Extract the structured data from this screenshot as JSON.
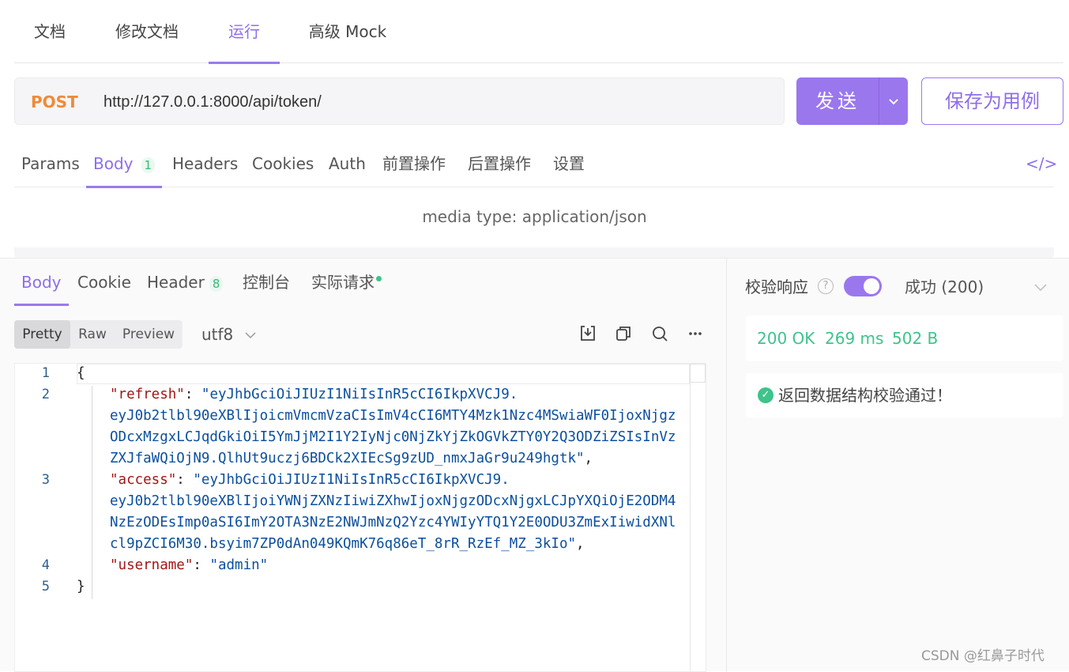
{
  "top_tabs": [
    "文档",
    "修改文档",
    "运行",
    "高级 Mock"
  ],
  "request": {
    "method": "POST",
    "url": "http://127.0.0.1:8000/api/token/",
    "send_label": "发送",
    "save_label": "保存为用例"
  },
  "req_tabs": {
    "params": "Params",
    "body": "Body",
    "body_count": "1",
    "headers": "Headers",
    "cookies": "Cookies",
    "auth": "Auth",
    "pre": "前置操作",
    "post": "后置操作",
    "settings": "设置",
    "code": "</>"
  },
  "media_type": "media type: application/json",
  "resp_tabs": {
    "body": "Body",
    "cookie": "Cookie",
    "header": "Header",
    "header_count": "8",
    "console": "控制台",
    "actual": "实际请求"
  },
  "view_modes": [
    "Pretty",
    "Raw",
    "Preview"
  ],
  "encoding": "utf8",
  "code_lines": {
    "l1": "{",
    "refresh_key": "\"refresh\"",
    "refresh_1": "\"eyJhbGciOiJIUzI1NiIsInR5cCI6IkpXVCJ9.",
    "refresh_2": "eyJ0b2tlbl90eXBlIjoicmVmcmVzaCIsImV4cCI6MTY4Mzk1Nzc4MSwiaWF0IjoxNjgz",
    "refresh_3": "ODcxMzgxLCJqdGkiOiI5YmJjM2I1Y2IyNjc0NjZkYjZkOGVkZTY0Y2Q3ODZiZSIsInVz",
    "refresh_4": "ZXJfaWQiOjN9.QlhUt9uczj6BDCk2XIEcSg9zUD_nmxJaGr9u249hgtk\"",
    "access_key": "\"access\"",
    "access_1": "\"eyJhbGciOiJIUzI1NiIsInR5cCI6IkpXVCJ9.",
    "access_2": "eyJ0b2tlbl90eXBlIjoiYWNjZXNzIiwiZXhwIjoxNjgzODcxNjgxLCJpYXQiOjE2ODM4",
    "access_3": "NzEzODEsImp0aSI6ImY2OTA3NzE2NWJmNzQ2Yzc4YWIyYTQ1Y2E0ODU3ZmExIiwidXNl",
    "access_4": "cl9pZCI6M30.bsyim7ZP0dAn049KQmK76q86eT_8rR_RzEf_MZ_3kIo\"",
    "username_key": "\"username\"",
    "username_val": "\"admin\"",
    "l5": "}",
    "ln": [
      "1",
      "2",
      "3",
      "4",
      "5"
    ]
  },
  "validation": {
    "label": "校验响应",
    "status_select": "成功 (200)",
    "status": "200 OK",
    "time": "269 ms",
    "size": "502 B",
    "result": "返回数据结构校验通过！"
  },
  "watermark": "CSDN @红鼻子时代",
  "colors": {
    "accent": "#9b77ee",
    "method": "#f08a38",
    "success": "#3fc38b"
  }
}
